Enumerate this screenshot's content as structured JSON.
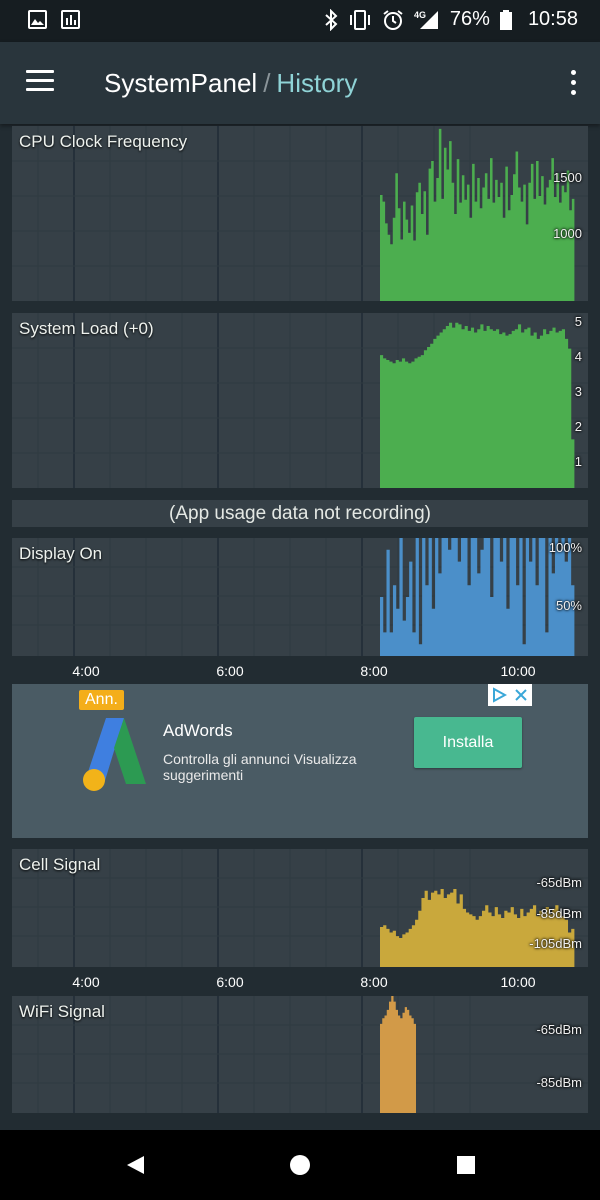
{
  "status_bar": {
    "left_icons": [
      "image-icon",
      "bar-chart-icon"
    ],
    "right_icons": [
      "bluetooth-icon",
      "vibrate-icon",
      "alarm-icon",
      "signal-4g-icon"
    ],
    "network": "4G",
    "battery": "76%",
    "time": "10:58"
  },
  "app_bar": {
    "title": "SystemPanel",
    "separator": "/",
    "subtitle": "History"
  },
  "colors": {
    "green": "#4cae4f",
    "blue": "#4b8fc9",
    "yellow": "#c9a83c",
    "orange": "#d29a48",
    "accent": "#8fd3d6"
  },
  "cpu_panel": {
    "title": "CPU Clock Frequency",
    "y_labels": [
      "1500",
      "1000"
    ],
    "chart_data": {
      "type": "area",
      "ylim": [
        0,
        1850
      ],
      "xlim": [
        2.4,
        10.9
      ],
      "values": [
        1120,
        1050,
        820,
        700,
        600,
        880,
        1350,
        980,
        650,
        1050,
        860,
        720,
        1010,
        640,
        1150,
        1250,
        920,
        1160,
        700,
        1400,
        1480,
        1050,
        1300,
        1820,
        1080,
        1620,
        1390,
        1690,
        1250,
        920,
        1500,
        1040,
        1330,
        1070,
        1230,
        880,
        1450,
        1050,
        1300,
        980,
        1200,
        1350,
        1080,
        1510,
        1040,
        1280,
        1100,
        1250,
        880,
        1420,
        960,
        1120,
        1340,
        1580,
        1200,
        1050,
        1230,
        810,
        1250,
        1450,
        1080,
        1480,
        1110,
        1320,
        1020,
        1200,
        1280,
        1510,
        1100,
        1350,
        1040,
        1220,
        1150,
        1380,
        960,
        1080
      ]
    }
  },
  "load_panel": {
    "title": "System Load (+0)",
    "y_labels": [
      "5",
      "4",
      "3",
      "2",
      "1"
    ],
    "chart_data": {
      "type": "area",
      "ylim": [
        0,
        5.4
      ],
      "xlim": [
        2.4,
        10.9
      ],
      "values": [
        4.1,
        4.0,
        3.95,
        3.9,
        3.85,
        3.95,
        3.9,
        4.0,
        3.9,
        3.85,
        3.9,
        4.0,
        4.05,
        4.1,
        4.25,
        4.35,
        4.45,
        4.6,
        4.7,
        4.8,
        4.9,
        5.0,
        5.1,
        4.95,
        5.1,
        5.05,
        4.9,
        5.0,
        4.85,
        4.95,
        4.8,
        4.9,
        5.05,
        4.85,
        5.0,
        4.9,
        4.85,
        4.9,
        4.75,
        4.8,
        4.7,
        4.75,
        4.85,
        4.9,
        5.05,
        4.8,
        4.9,
        4.95,
        4.7,
        4.8,
        4.6,
        4.7,
        4.9,
        4.75,
        4.85,
        4.95,
        4.8,
        4.85,
        4.9,
        4.6,
        4.3,
        1.5
      ]
    }
  },
  "notice": "(App usage data not recording)",
  "display_panel": {
    "title": "Display On",
    "y_labels": [
      "100%",
      "50%"
    ],
    "chart_data": {
      "type": "area",
      "ylim": [
        0,
        100
      ],
      "xlim": [
        2.4,
        10.9
      ],
      "values": [
        50,
        20,
        90,
        20,
        60,
        40,
        100,
        30,
        50,
        80,
        20,
        100,
        10,
        100,
        60,
        100,
        40,
        100,
        70,
        100,
        100,
        90,
        100,
        100,
        80,
        100,
        100,
        60,
        100,
        100,
        70,
        90,
        100,
        100,
        50,
        100,
        100,
        80,
        100,
        40,
        100,
        100,
        60,
        100,
        10,
        100,
        80,
        100,
        60,
        100,
        100,
        20,
        100,
        70,
        100,
        90,
        100,
        80,
        100,
        60
      ]
    }
  },
  "time_axis": [
    "4:00",
    "6:00",
    "8:00",
    "10:00"
  ],
  "ad": {
    "badge": "Ann.",
    "title": "AdWords",
    "description": "Controlla gli annunci Visualizza suggerimenti",
    "button": "Installa"
  },
  "cell_panel": {
    "title": "Cell Signal",
    "y_labels": [
      "-65dBm",
      "-85dBm",
      "-105dBm"
    ],
    "chart_data": {
      "type": "area",
      "ylim": [
        -120,
        -55
      ],
      "xlim": [
        2.4,
        10.9
      ],
      "values": [
        -98,
        -97,
        -99,
        -101,
        -100,
        -103,
        -104,
        -102,
        -101,
        -99,
        -97,
        -94,
        -89,
        -82,
        -78,
        -83,
        -79,
        -78,
        -80,
        -77,
        -82,
        -80,
        -79,
        -77,
        -85,
        -80,
        -88,
        -90,
        -91,
        -92,
        -94,
        -92,
        -89,
        -86,
        -90,
        -92,
        -87,
        -91,
        -93,
        -89,
        -90,
        -87,
        -91,
        -93,
        -88,
        -92,
        -90,
        -88,
        -86,
        -92,
        -89,
        -90,
        -87,
        -91,
        -88,
        -86,
        -90,
        -92,
        -94,
        -101,
        -99
      ]
    }
  },
  "wifi_panel": {
    "title": "WiFi Signal",
    "y_labels": [
      "-65dBm",
      "-85dBm"
    ],
    "chart_data": {
      "type": "area",
      "ylim": [
        -92,
        -50
      ],
      "xlim": [
        2.4,
        10.9
      ],
      "start": 8.25,
      "end": 8.75,
      "values": [
        -60,
        -58,
        -57,
        -55,
        -52,
        -50,
        -52,
        -55,
        -57,
        -58,
        -56,
        -54,
        -55,
        -57,
        -58,
        -60
      ]
    }
  },
  "nav": {
    "buttons": [
      "back-icon",
      "home-icon",
      "recents-icon"
    ]
  }
}
